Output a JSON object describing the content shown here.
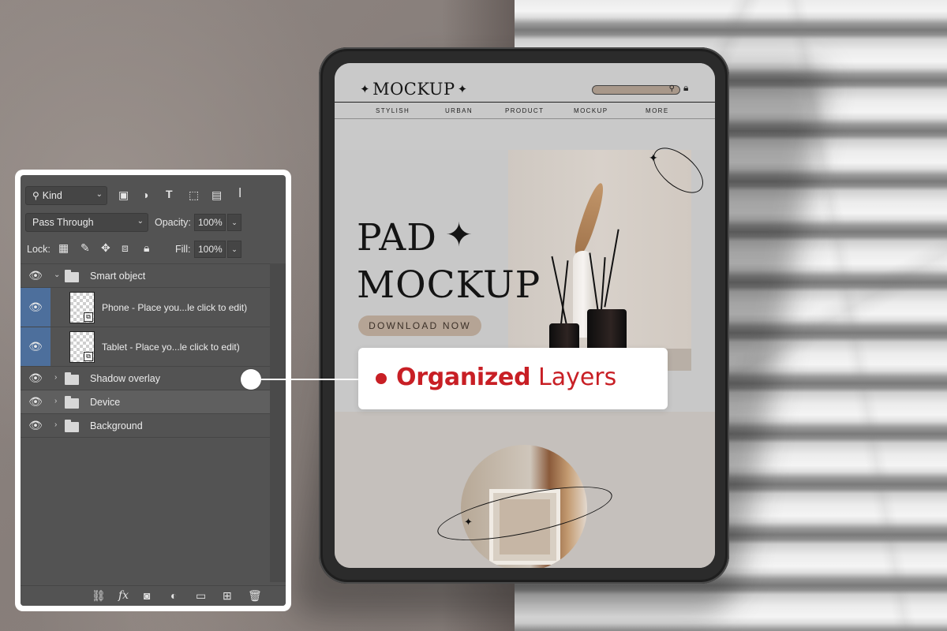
{
  "mockup_site": {
    "logo_text": "MOCKUP",
    "nav_items": [
      "STYLISH",
      "URBAN",
      "PRODUCT",
      "MOCKUP",
      "MORE"
    ],
    "hero_line1": "PAD",
    "hero_line2": "MOCKUP",
    "cta_label": "DOWNLOAD NOW"
  },
  "layers_panel": {
    "filter_kind": "Kind",
    "blend_mode": "Pass Through",
    "opacity_label": "Opacity:",
    "opacity_value": "100%",
    "lock_label": "Lock:",
    "fill_label": "Fill:",
    "fill_value": "100%",
    "layers": [
      {
        "name": "Smart object",
        "type": "group",
        "expanded": true,
        "visible": true
      },
      {
        "name": "Phone - Place you...le click to edit)",
        "type": "smart-object",
        "visible": true,
        "indent": 1
      },
      {
        "name": "Tablet - Place yo...le click to edit)",
        "type": "smart-object",
        "visible": true,
        "indent": 1
      },
      {
        "name": "Shadow overlay",
        "type": "group",
        "expanded": false,
        "visible": true
      },
      {
        "name": "Device",
        "type": "group",
        "expanded": false,
        "visible": true,
        "selected": true
      },
      {
        "name": "Background",
        "type": "group",
        "expanded": false,
        "visible": true
      }
    ]
  },
  "callout": {
    "strong_text": "Organized",
    "light_text": "Layers"
  },
  "colors": {
    "accent_red": "#c81f25",
    "panel_bg": "#535353",
    "eye_active_bg": "#4d6f9c",
    "cta_bg": "#b5a495"
  },
  "icons": {
    "search": "search-icon",
    "eye": "eye-icon",
    "folder": "folder-icon",
    "lock": "lock-icon",
    "trash": "trash-icon"
  }
}
